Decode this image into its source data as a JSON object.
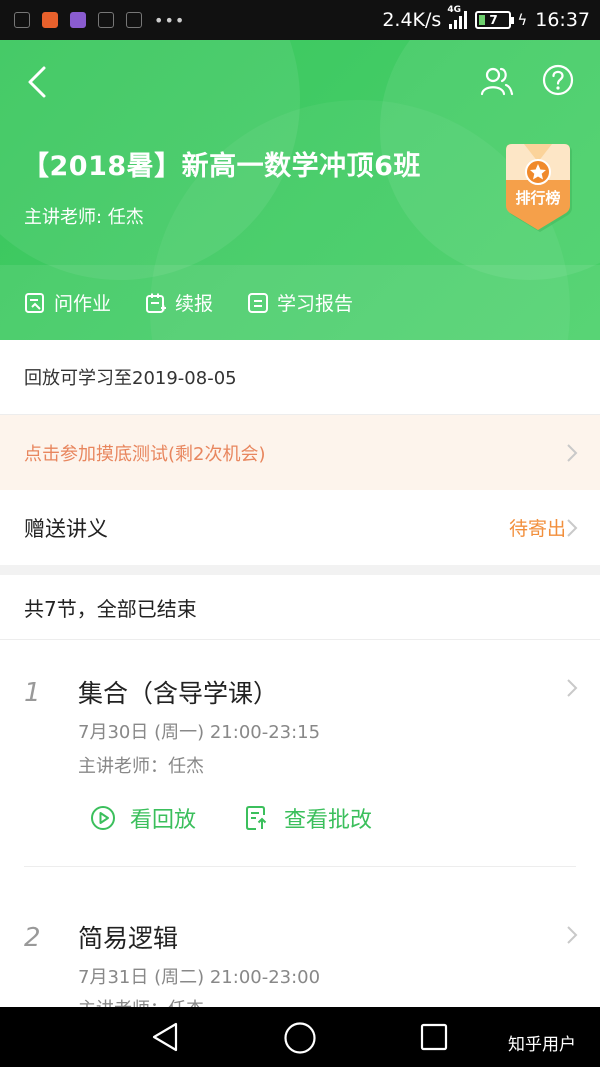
{
  "status_bar": {
    "speed": "2.4K/s",
    "network": "4G",
    "battery": "7",
    "time": "16:37"
  },
  "header": {
    "title": "【2018暑】新高一数学冲顶6班",
    "teacher": "主讲老师:  任杰",
    "rank_badge": "排行榜",
    "actions": [
      {
        "label": "问作业",
        "icon": "homework-icon"
      },
      {
        "label": "续报",
        "icon": "renew-icon"
      },
      {
        "label": "学习报告",
        "icon": "report-icon"
      }
    ]
  },
  "replay_notice": "回放可学习至2019-08-05",
  "placement_test": "点击参加摸底测试(剩2次机会)",
  "handout": {
    "label": "赠送讲义",
    "status": "待寄出"
  },
  "summary": "共7节，全部已结束",
  "lessons": [
    {
      "index": "1",
      "name": "集合（含导学课）",
      "time": "7月30日 (周一)   21:00-23:15",
      "teacher": "主讲老师：任杰",
      "replay_label": "看回放",
      "review_label": "查看批改"
    },
    {
      "index": "2",
      "name": "简易逻辑",
      "time": "7月31日 (周二)   21:00-23:00",
      "teacher": "主讲老师：任杰"
    }
  ],
  "watermark": "知乎用户",
  "colors": {
    "brand_green": "#43cc66",
    "accent_orange": "#f28f3c",
    "test_text": "#e8865e"
  }
}
